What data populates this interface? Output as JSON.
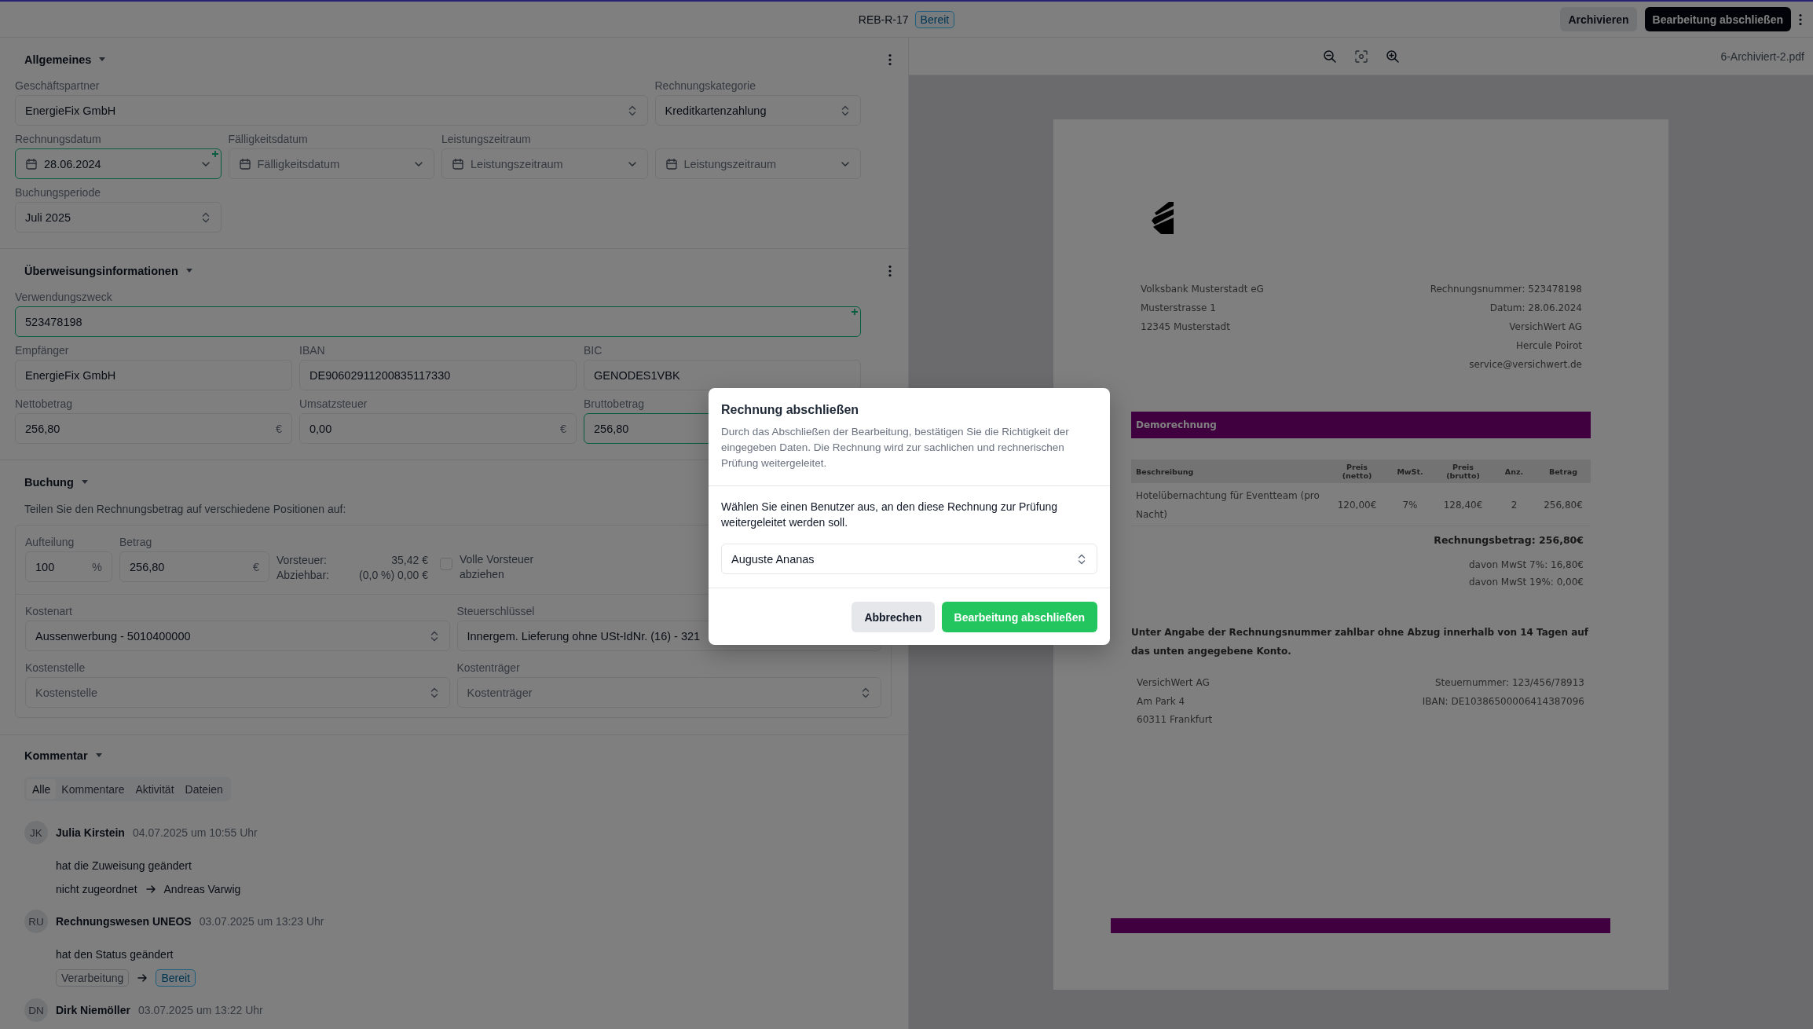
{
  "header": {
    "title": "REB-R-17",
    "status": {
      "label": "Bereit",
      "kind": "info"
    },
    "actions": [
      {
        "label": "Archivieren",
        "kind": "secondary"
      },
      {
        "label": "Bearbeitung abschließen",
        "kind": "primary"
      }
    ]
  },
  "general": {
    "title": "Allgemeines",
    "fields": [
      {
        "label": "Geschäftspartner",
        "kind": "select",
        "value": "EnergieFix GmbH",
        "suggested": false,
        "ai_mark": false
      },
      {
        "label": "Rechnungskategorie",
        "kind": "select",
        "value": "Kreditkartenzahlung",
        "suggested": false,
        "ai_mark": false
      },
      {
        "label": "Rechnungsdatum",
        "kind": "date",
        "value": "28.06.2024",
        "suggested": true,
        "ai_mark": true
      },
      {
        "label": "Fälligkeitsdatum",
        "kind": "date",
        "placeholder": "Fälligkeitsdatum",
        "suggested": false,
        "ai_mark": false
      },
      {
        "label": "Leistungszeitraum",
        "kind": "date",
        "placeholder": "Leistungszeitraum",
        "suggested": false,
        "ai_mark": false
      },
      {
        "kind": "date",
        "placeholder": "Leistungszeitraum",
        "suggested": false,
        "ai_mark": false
      },
      {
        "label": "Buchungsperiode",
        "kind": "select",
        "value": "Juli 2025",
        "suggested": false,
        "ai_mark": false
      }
    ]
  },
  "transfer": {
    "title": "Überweisungsinformationen",
    "fields": [
      {
        "label": "Verwendungszweck",
        "kind": "text",
        "value": "523478198",
        "suggested": true,
        "ai_mark": true
      },
      {
        "label": "Empfänger",
        "kind": "text",
        "value": "EnergieFix GmbH",
        "suggested": false,
        "ai_mark": false
      },
      {
        "label": "IBAN",
        "kind": "text",
        "value": "DE90602911200835117330",
        "suggested": false,
        "ai_mark": false
      },
      {
        "label": "BIC",
        "kind": "text",
        "value": "GENODES1VBK",
        "suggested": false,
        "ai_mark": false
      },
      {
        "label": "Nettobetrag",
        "kind": "text",
        "value": "256,80",
        "suffix": "€",
        "suggested": false,
        "ai_mark": false
      },
      {
        "label": "Umsatzsteuer",
        "kind": "text",
        "value": "0,00",
        "suffix": "€",
        "suggested": false,
        "ai_mark": false
      },
      {
        "label": "Bruttobetrag",
        "kind": "text",
        "value": "256,80",
        "suggested": true,
        "ai_mark": false
      }
    ]
  },
  "booking": {
    "title": "Buchung",
    "hint": "Teilen Sie den Rechnungsbetrag auf verschiedene Positionen auf:",
    "split": {
      "label": "Aufteilung",
      "kind": "text",
      "value": "100",
      "suffix": "%"
    },
    "amount": {
      "label": "Betrag",
      "kind": "text",
      "value": "256,80",
      "suffix": "€"
    },
    "tax": [
      {
        "label": "Vorsteuer:",
        "value": "35,42 €"
      },
      {
        "label": "Abziehbar:",
        "value": "(0,0 %) 0,00 €"
      }
    ],
    "full_tax": {
      "label": "Volle Vorsteuer abziehen",
      "checked": false
    },
    "fields": [
      {
        "label": "Kostenart",
        "kind": "select",
        "value": "Aussenwerbung - 5010400000"
      },
      {
        "label": "Steuerschlüssel",
        "kind": "text",
        "value": "Innergem. Lieferung ohne USt-IdNr. (16) - 321"
      },
      {
        "label": "Kostenstelle",
        "kind": "select",
        "placeholder": "Kostenstelle"
      },
      {
        "label": "Kostenträger",
        "kind": "select",
        "placeholder": "Kostenträger"
      }
    ]
  },
  "comments": {
    "title": "Kommentar",
    "tabs": [
      {
        "label": "Alle",
        "selected": true
      },
      {
        "label": "Kommentare",
        "selected": false
      },
      {
        "label": "Aktivität",
        "selected": false
      },
      {
        "label": "Dateien",
        "selected": false
      }
    ],
    "entries": [
      {
        "initials": "JK",
        "author": "Julia Kirstein",
        "time": "04.07.2025 um 10:55 Uhr",
        "action": "hat die Zuweisung geändert",
        "change": {
          "kind": "text",
          "from": {
            "label": "nicht zugeordnet"
          },
          "to": {
            "label": "Andreas Varwig"
          }
        }
      },
      {
        "initials": "RU",
        "author": "Rechnungswesen UNEOS",
        "time": "03.07.2025 um 13:23 Uhr",
        "action": "hat den Status geändert",
        "change": {
          "kind": "status",
          "from": {
            "label": "Verarbeitung",
            "kind": "neutral"
          },
          "to": {
            "label": "Bereit",
            "kind": "info"
          }
        }
      },
      {
        "initials": "DN",
        "author": "Dirk Niemöller",
        "time": "03.07.2025 um 13:22 Uhr"
      }
    ]
  },
  "viewer": {
    "filename": "6-Archiviert-2.pdf"
  },
  "document": {
    "sender": [
      "Volksbank Musterstadt eG",
      "Musterstrasse 1",
      "12345 Musterstadt"
    ],
    "meta": [
      "Rechnungsnummer: 523478198",
      "Datum: 28.06.2024",
      "VersichWert AG",
      "Hercule Poirot",
      "service@versichwert.de"
    ],
    "banner": "Demorechnung",
    "table": {
      "columns": [
        "Beschreibung",
        "Preis (netto)",
        "MwSt.",
        "Preis (brutto)",
        "Anz.",
        "Betrag"
      ],
      "rows": [
        [
          "Hotelübernachtung für Eventteam (pro Nacht)",
          "120,00€",
          "7%",
          "128,40€",
          "2",
          "256,80€"
        ]
      ]
    },
    "total": "Rechnungsbetrag: 256,80€",
    "tax_lines": [
      "davon MwSt 7%: 16,80€",
      "davon MwSt 19%: 0,00€"
    ],
    "payment_note": "Unter Angabe der Rechnungsnummer zahlbar ohne Abzug innerhalb von 14 Tagen auf das unten angegebene Konto.",
    "footer_left": [
      "VersichWert AG",
      "Am Park 4",
      "60311 Frankfurt"
    ],
    "footer_right": [
      "Steuernummer: 123/456/78913",
      "IBAN: DE10386500006414387096"
    ]
  },
  "modal": {
    "title": "Rechnung abschließen",
    "description": "Durch das Abschließen der Bearbeitung, bestätigen Sie die Richtigkeit der eingegeben Daten. Die Rechnung wird zur sachlichen und rechnerischen Prüfung weitergeleitet.",
    "prompt": "Wählen Sie einen Benutzer aus, an den diese Rechnung zur Prüfung weitergeleitet werden soll.",
    "user": "Auguste Ananas",
    "actions": [
      {
        "label": "Abbrechen",
        "kind": "secondary"
      },
      {
        "label": "Bearbeitung abschließen",
        "kind": "success"
      }
    ]
  }
}
